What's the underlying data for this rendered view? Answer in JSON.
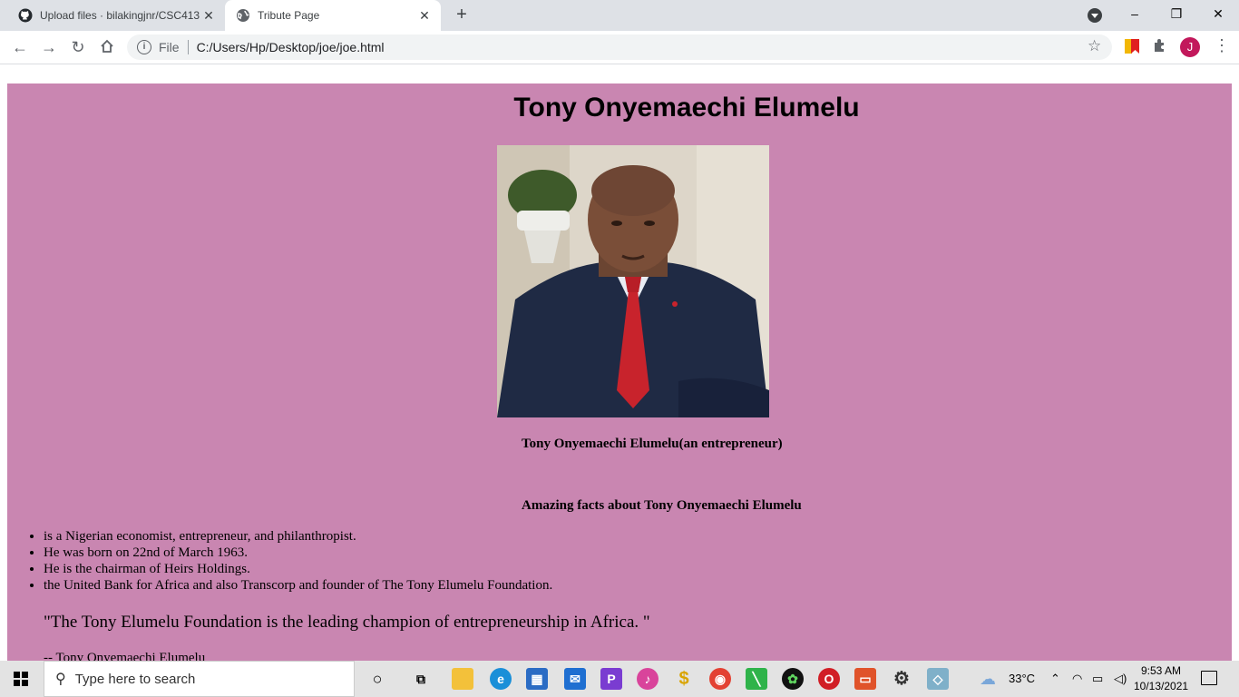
{
  "browser": {
    "tabs": [
      {
        "title": "Upload files · bilakingjnr/CSC413",
        "close": "✕",
        "icon": "github-icon"
      },
      {
        "title": "Tribute Page",
        "close": "✕",
        "icon": "globe-icon"
      }
    ],
    "new_tab": "+",
    "address": {
      "scheme_label": "File",
      "url": "C:/Users/Hp/Desktop/joe/joe.html"
    },
    "profile_initial": "J",
    "window_controls": {
      "minimize": "–",
      "restore": "❐",
      "close": "✕"
    }
  },
  "page": {
    "heading": "Tony Onyemaechi Elumelu",
    "image_caption": "Tony Onyemaechi Elumelu(an entrepreneur)",
    "facts_heading": "Amazing facts about Tony Onyemaechi Elumelu",
    "facts": [
      "is a Nigerian economist, entrepreneur, and philanthropist.",
      "He was born on 22nd of March 1963.",
      "He is the chairman of Heirs Holdings.",
      "the United Bank for Africa and also Transcorp and founder of The Tony Elumelu Foundation."
    ],
    "quote": "\"The Tony Elumelu Foundation is the leading champion of entrepreneurship in Africa. \"",
    "attribution": "-- Tony Onyemaechi Elumelu",
    "background_color": "#c986b1"
  },
  "taskbar": {
    "search_placeholder": "Type here to search",
    "weather": "33°C",
    "time": "9:53 AM",
    "date": "10/13/2021"
  }
}
